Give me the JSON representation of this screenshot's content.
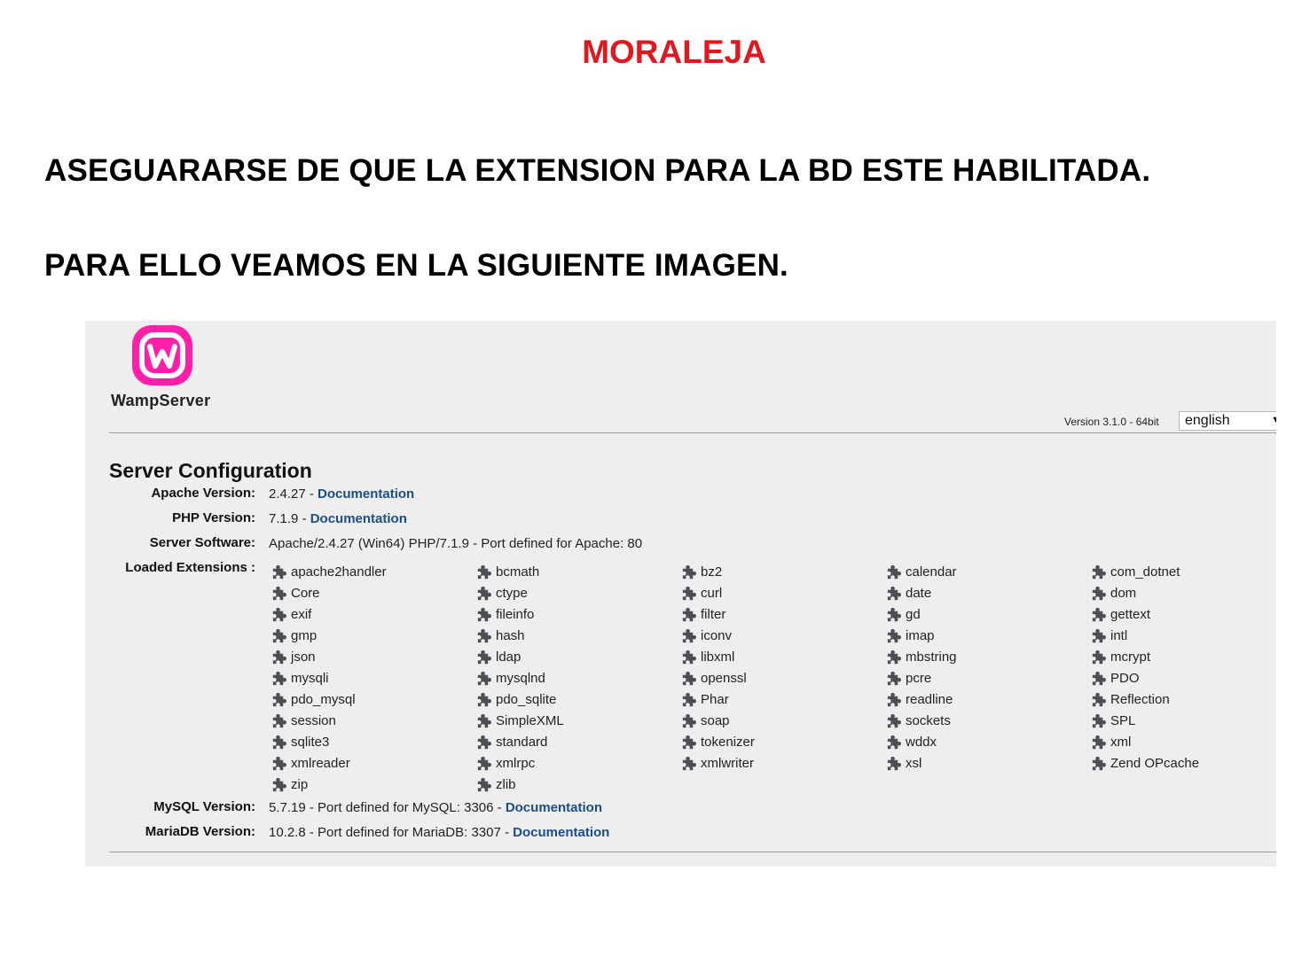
{
  "slide": {
    "title": "MORALEJA",
    "line1": "ASEGUARARSE DE QUE LA EXTENSION PARA LA BD ESTE HABILITADA.",
    "line2": "PARA ELLO VEAMOS EN LA SIGUIENTE IMAGEN."
  },
  "wamp": {
    "brand": "WampServer",
    "version": "Version 3.1.0 - 64bit",
    "language": "english",
    "section_title": "Server Configuration",
    "apache": {
      "label": "Apache Version:",
      "value": "2.4.27  - ",
      "link": "Documentation"
    },
    "php": {
      "label": "PHP Version:",
      "value": "7.1.9  - ",
      "link": "Documentation"
    },
    "software": {
      "label": "Server Software:",
      "value": "Apache/2.4.27 (Win64) PHP/7.1.9 - Port defined for Apache: 80"
    },
    "extensions_label": "Loaded Extensions :",
    "extensions": [
      "apache2handler",
      "bcmath",
      "bz2",
      "calendar",
      "com_dotnet",
      "Core",
      "ctype",
      "curl",
      "date",
      "dom",
      "exif",
      "fileinfo",
      "filter",
      "gd",
      "gettext",
      "gmp",
      "hash",
      "iconv",
      "imap",
      "intl",
      "json",
      "ldap",
      "libxml",
      "mbstring",
      "mcrypt",
      "mysqli",
      "mysqlnd",
      "openssl",
      "pcre",
      "PDO",
      "pdo_mysql",
      "pdo_sqlite",
      "Phar",
      "readline",
      "Reflection",
      "session",
      "SimpleXML",
      "soap",
      "sockets",
      "SPL",
      "sqlite3",
      "standard",
      "tokenizer",
      "wddx",
      "xml",
      "xmlreader",
      "xmlrpc",
      "xmlwriter",
      "xsl",
      "Zend OPcache",
      "zip",
      "zlib"
    ],
    "mysql": {
      "label": "MySQL Version:",
      "value": "5.7.19 - Port defined for MySQL: 3306 -  ",
      "link": "Documentation"
    },
    "mariadb": {
      "label": "MariaDB Version:",
      "value": "10.2.8 - Port defined for MariaDB: 3307 -  ",
      "link": "Documentation"
    },
    "colors": {
      "accent": "#ff1fa8",
      "link": "#1b4d89",
      "title_red": "#e0191f"
    },
    "icons": {
      "extension": "puzzle-piece-icon",
      "logo": "wampserver-logo"
    }
  }
}
